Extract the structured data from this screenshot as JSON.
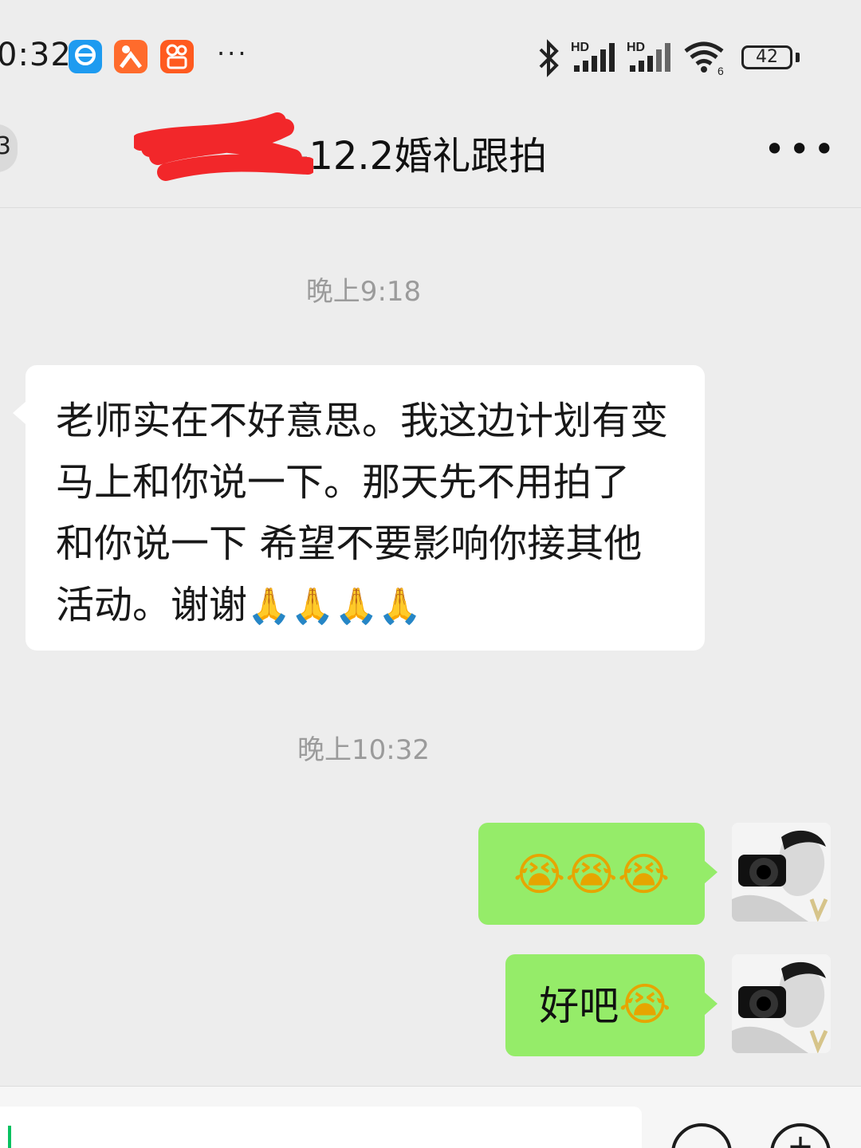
{
  "status_bar": {
    "time": "0:32",
    "more": "···",
    "signal1_label": "HD",
    "signal2_label": "HD",
    "wifi_label": "6",
    "battery": "42"
  },
  "nav": {
    "back_badge": "3",
    "title": "-12.2婚礼跟拍",
    "more": "•••"
  },
  "messages": [
    {
      "timestamp": "晚上9:18",
      "direction": "incoming",
      "text": "老师实在不好意思。我这边计划有变 马上和你说一下。那天先不用拍了 和你说一下 希望不要影响你接其他活动。谢谢",
      "emojis": [
        "🙏",
        "🙏",
        "🙏",
        "🙏"
      ]
    },
    {
      "timestamp": "晚上10:32",
      "direction": "outgoing",
      "text": "",
      "emojis": [
        "😭",
        "😭",
        "😭"
      ]
    },
    {
      "direction": "outgoing",
      "text": "好吧",
      "emojis": [
        "😭"
      ]
    }
  ],
  "icons": {
    "status_apps": [
      "browser-app-icon",
      "dianping-app-icon",
      "kuaishou-app-icon"
    ],
    "avatar": "photographer-avatar",
    "input_buttons": [
      "voice-icon",
      "plus-icon"
    ]
  },
  "colors": {
    "background": "#ededed",
    "incoming_bubble": "#ffffff",
    "outgoing_bubble": "#95ec69",
    "cursor": "#07c160"
  }
}
